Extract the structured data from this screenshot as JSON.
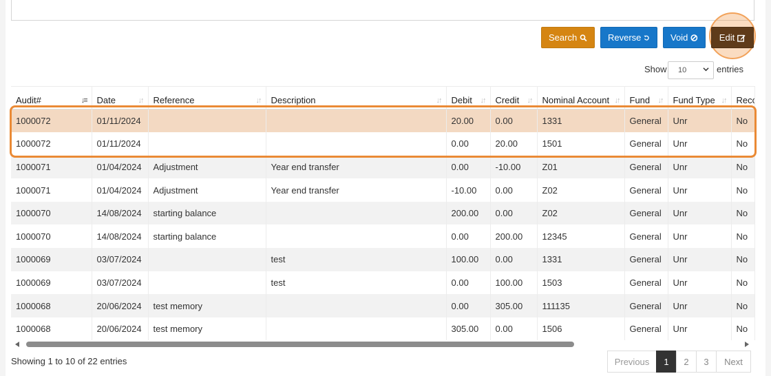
{
  "toolbar": {
    "search_label": "Search",
    "reverse_label": "Reverse",
    "void_label": "Void",
    "edit_label": "Edit"
  },
  "length": {
    "show_label": "Show",
    "value": "10",
    "entries_label": "entries"
  },
  "table": {
    "columns": [
      "Audit#",
      "Date",
      "Reference",
      "Description",
      "Debit",
      "Credit",
      "Nominal Account",
      "Fund",
      "Fund Type",
      "Reco"
    ],
    "rows": [
      {
        "audit": "1000072",
        "date": "01/11/2024",
        "reference": "",
        "description": "",
        "debit": "20.00",
        "credit": "0.00",
        "nominal": "1331",
        "fund": "General",
        "fund_type": "Unr",
        "reco": "No"
      },
      {
        "audit": "1000072",
        "date": "01/11/2024",
        "reference": "",
        "description": "",
        "debit": "0.00",
        "credit": "20.00",
        "nominal": "1501",
        "fund": "General",
        "fund_type": "Unr",
        "reco": "No"
      },
      {
        "audit": "1000071",
        "date": "01/04/2024",
        "reference": "Adjustment",
        "description": "Year end transfer",
        "debit": "0.00",
        "credit": "-10.00",
        "nominal": "Z01",
        "fund": "General",
        "fund_type": "Unr",
        "reco": "No"
      },
      {
        "audit": "1000071",
        "date": "01/04/2024",
        "reference": "Adjustment",
        "description": "Year end transfer",
        "debit": "-10.00",
        "credit": "0.00",
        "nominal": "Z02",
        "fund": "General",
        "fund_type": "Unr",
        "reco": "No"
      },
      {
        "audit": "1000070",
        "date": "14/08/2024",
        "reference": "starting balance",
        "description": "",
        "debit": "200.00",
        "credit": "0.00",
        "nominal": "Z02",
        "fund": "General",
        "fund_type": "Unr",
        "reco": "No"
      },
      {
        "audit": "1000070",
        "date": "14/08/2024",
        "reference": "starting balance",
        "description": "",
        "debit": "0.00",
        "credit": "200.00",
        "nominal": "12345",
        "fund": "General",
        "fund_type": "Unr",
        "reco": "No"
      },
      {
        "audit": "1000069",
        "date": "03/07/2024",
        "reference": "",
        "description": "test",
        "debit": "100.00",
        "credit": "0.00",
        "nominal": "1331",
        "fund": "General",
        "fund_type": "Unr",
        "reco": "No"
      },
      {
        "audit": "1000069",
        "date": "03/07/2024",
        "reference": "",
        "description": "test",
        "debit": "0.00",
        "credit": "100.00",
        "nominal": "1503",
        "fund": "General",
        "fund_type": "Unr",
        "reco": "No"
      },
      {
        "audit": "1000068",
        "date": "20/06/2024",
        "reference": "test memory",
        "description": "",
        "debit": "0.00",
        "credit": "305.00",
        "nominal": "111135",
        "fund": "General",
        "fund_type": "Unr",
        "reco": "No"
      },
      {
        "audit": "1000068",
        "date": "20/06/2024",
        "reference": "test memory",
        "description": "",
        "debit": "305.00",
        "credit": "0.00",
        "nominal": "1506",
        "fund": "General",
        "fund_type": "Unr",
        "reco": "No"
      }
    ]
  },
  "info_text": "Showing 1 to 10 of 22 entries",
  "pagination": {
    "previous_label": "Previous",
    "pages": [
      "1",
      "2",
      "3"
    ],
    "current_page": "1",
    "next_label": "Next"
  },
  "colors": {
    "search": "#d58512",
    "primary": "#1777c9",
    "edit": "#5f3b1a",
    "highlight": "#ea8a35"
  }
}
